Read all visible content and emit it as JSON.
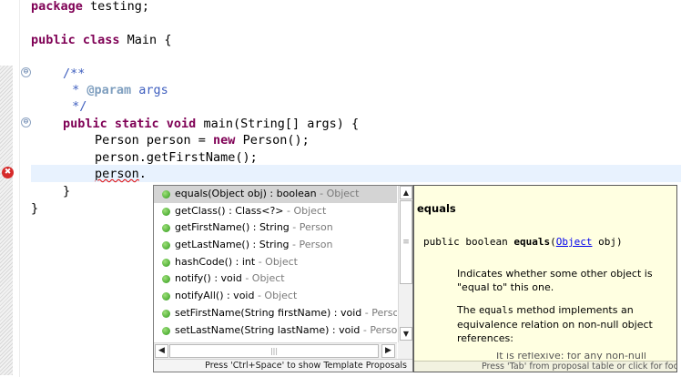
{
  "editor": {
    "package_kw": "package",
    "package_name": " testing;",
    "class_kw": "public class",
    "class_rest": " Main {",
    "comment_open": "/**",
    "param_prefix": " * ",
    "param_tag": "@param",
    "param_name": " args",
    "comment_close": " */",
    "method_kw": "public static void",
    "method_rest": " main(String[] args) {",
    "line_person_a": "Person person = ",
    "line_person_new": "new",
    "line_person_b": " Person();",
    "line_getfirst": "person.getFirstName();",
    "line_current": "person",
    "line_current_dot": ".",
    "close_method": "}",
    "close_class": "}",
    "fold_glyph": "⊖",
    "error_glyph": "✖"
  },
  "proposals": {
    "items": [
      {
        "sig": "equals(Object obj) : boolean",
        "owner": " - Object",
        "selected": true
      },
      {
        "sig": "getClass() : Class<?>",
        "owner": " - Object"
      },
      {
        "sig": "getFirstName() : String",
        "owner": " - Person"
      },
      {
        "sig": "getLastName() : String",
        "owner": " - Person"
      },
      {
        "sig": "hashCode() : int",
        "owner": " - Object"
      },
      {
        "sig": "notify() : void",
        "owner": " - Object"
      },
      {
        "sig": "notifyAll() : void",
        "owner": " - Object"
      },
      {
        "sig": "setFirstName(String firstName) : void",
        "owner": " - Person"
      },
      {
        "sig": "setLastName(String lastName) : void",
        "owner": " - Person"
      }
    ],
    "status": "Press 'Ctrl+Space' to show Template Proposals",
    "scroll_up": "▲",
    "scroll_down": "▼",
    "scroll_left": "◀",
    "scroll_right": "▶",
    "vgrip": "≡",
    "hgrip": "|||"
  },
  "javadoc": {
    "title": "equals",
    "sig_prefix": "public boolean ",
    "sig_name": "equals",
    "sig_open": "(",
    "sig_link": "Object",
    "sig_rest": " obj)",
    "p1": "Indicates whether some other object is \"equal to\" this one.",
    "p2_a": "The ",
    "p2_code": "equals",
    "p2_b": " method implements an equivalence relation on non-null object references:",
    "cut_text": "It is reflexive: for any non-null",
    "status": "Press 'Tab' from proposal table or click for focus"
  },
  "colors": {
    "keyword": "#7f0055",
    "javadoc_comment": "#3f5fbf",
    "javadoc_tag": "#7f9fbf",
    "current_line": "#e8f2fe",
    "hover_background": "#ffffe1",
    "error": "#d62a2a",
    "proposal_owner": "#7a7a7a",
    "link": "#0000ee"
  }
}
